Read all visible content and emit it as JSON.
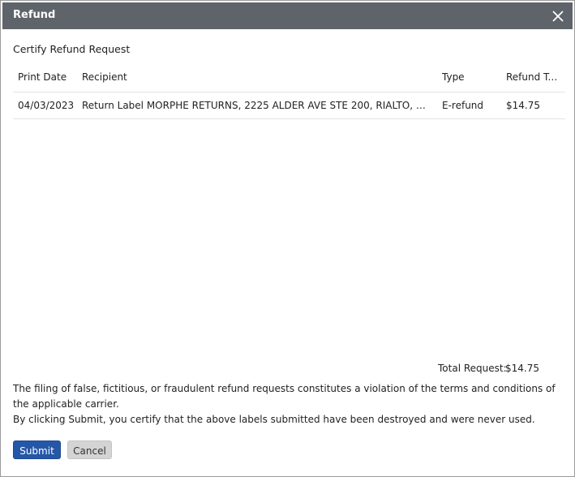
{
  "dialog": {
    "title": "Refund",
    "section_title": "Certify Refund Request"
  },
  "table": {
    "columns": [
      "Print Date",
      "Recipient",
      "Type",
      "Refund To..."
    ],
    "rows": [
      {
        "print_date": "04/03/2023",
        "recipient": "Return Label MORPHE RETURNS, 2225 ALDER AVE STE 200, RIALTO, CA 92377-851...",
        "type": "E-refund",
        "refund_total": "$14.75"
      }
    ]
  },
  "summary": {
    "total_label": "Total Request:",
    "total_value": "$14.75"
  },
  "notice": {
    "line1": "The filing of false, fictitious, or fraudulent refund requests constitutes a violation of the terms and conditions of the applicable carrier.",
    "line2": "By clicking Submit, you certify that the above labels submitted have been destroyed and were never used."
  },
  "buttons": {
    "submit_label": "Submit",
    "cancel_label": "Cancel"
  },
  "icons": {
    "close": "close-icon"
  },
  "colors": {
    "titlebar": "#5f646b",
    "primary": "#2557a7",
    "secondary": "#d4d4d4"
  }
}
